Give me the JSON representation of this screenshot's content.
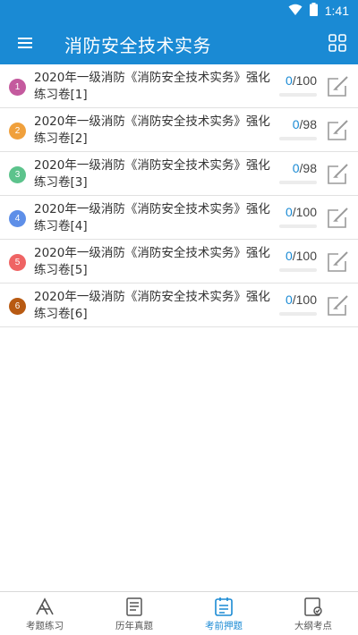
{
  "status_bar": {
    "time": "1:41",
    "wifi_icon": "wifi-icon",
    "battery_icon": "battery-icon"
  },
  "app_bar": {
    "title": "消防安全技术实务",
    "menu_icon": "menu-icon",
    "grid_icon": "grid-icon"
  },
  "list": {
    "items": [
      {
        "index": "1",
        "title": "2020年一级消防《消防安全技术实务》强化练习卷[1]",
        "done": "0",
        "total": "/100",
        "color": "#c45a9e"
      },
      {
        "index": "2",
        "title": "2020年一级消防《消防安全技术实务》强化练习卷[2]",
        "done": "0",
        "total": "/98",
        "color": "#f0a03c"
      },
      {
        "index": "3",
        "title": "2020年一级消防《消防安全技术实务》强化练习卷[3]",
        "done": "0",
        "total": "/98",
        "color": "#5cc38c"
      },
      {
        "index": "4",
        "title": "2020年一级消防《消防安全技术实务》强化练习卷[4]",
        "done": "0",
        "total": "/100",
        "color": "#5e8fe8"
      },
      {
        "index": "5",
        "title": "2020年一级消防《消防安全技术实务》强化练习卷[5]",
        "done": "0",
        "total": "/100",
        "color": "#ef6464"
      },
      {
        "index": "6",
        "title": "2020年一级消防《消防安全技术实务》强化练习卷[6]",
        "done": "0",
        "total": "/100",
        "color": "#b85a12"
      }
    ]
  },
  "tabs": [
    {
      "label": "考题练习",
      "icon": "exam-practice-icon",
      "active": false
    },
    {
      "label": "历年真题",
      "icon": "past-papers-icon",
      "active": false
    },
    {
      "label": "考前押题",
      "icon": "predicted-questions-icon",
      "active": true
    },
    {
      "label": "大纲考点",
      "icon": "syllabus-icon",
      "active": false
    }
  ],
  "colors": {
    "primary": "#1a8ad4",
    "text": "#333333",
    "divider": "#e1e1e1"
  }
}
